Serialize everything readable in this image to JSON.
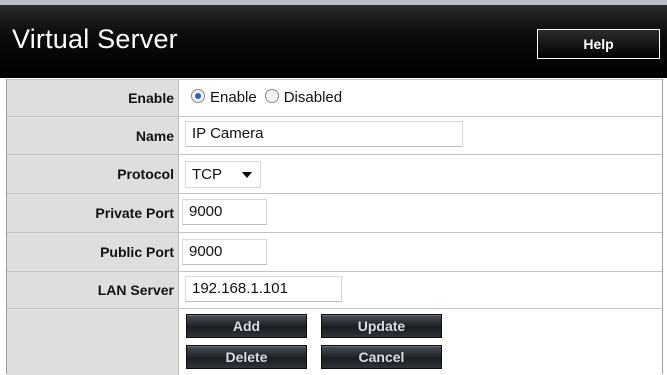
{
  "header": {
    "title": "Virtual Server",
    "help_label": "Help"
  },
  "form": {
    "enable": {
      "label": "Enable",
      "options": [
        "Enable",
        "Disabled"
      ],
      "selected": "Enable"
    },
    "name": {
      "label": "Name",
      "value": "IP Camera"
    },
    "protocol": {
      "label": "Protocol",
      "value": "TCP"
    },
    "private_port": {
      "label": "Private Port",
      "value": "9000"
    },
    "public_port": {
      "label": "Public Port",
      "value": "9000"
    },
    "lan_server": {
      "label": "LAN Server",
      "value": "192.168.1.101"
    }
  },
  "buttons": {
    "add": "Add",
    "update": "Update",
    "delete": "Delete",
    "cancel": "Cancel"
  }
}
